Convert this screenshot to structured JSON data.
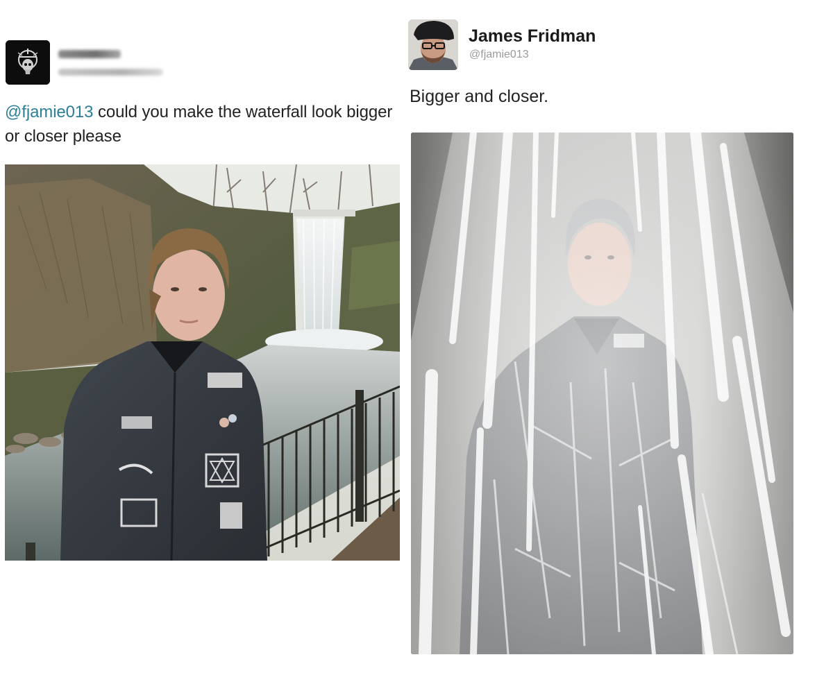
{
  "left_tweet": {
    "mention": "@fjamie013",
    "text_rest": " could you make the waterfall look bigger or closer please",
    "avatar_icon": "skull-emblem-icon",
    "photo_subject": "waterfall-portrait-photo"
  },
  "right_tweet": {
    "author_name": "James Fridman",
    "author_handle": "@fjamie013",
    "text": "Bigger and closer.",
    "avatar_icon": "beanie-glasses-avatar",
    "photo_subject": "under-waterfall-photo"
  },
  "colors": {
    "mention": "#2d7f98",
    "text": "#222222",
    "handle": "#9a9a9a"
  }
}
